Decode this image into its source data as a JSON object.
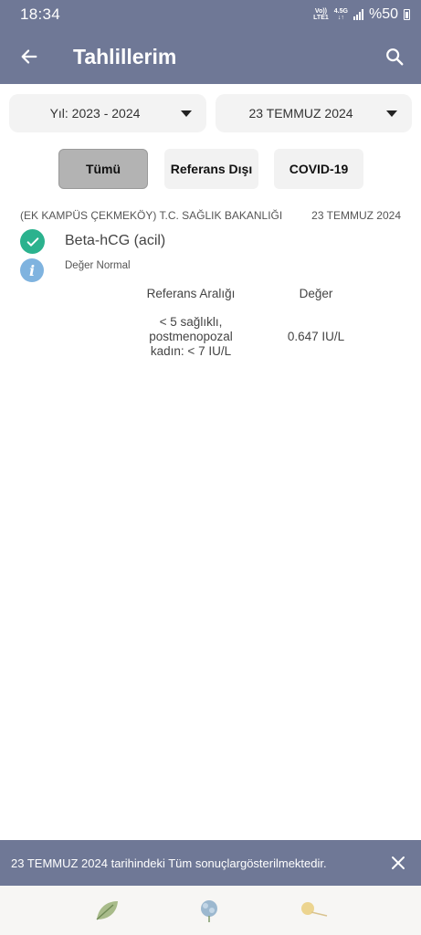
{
  "status_bar": {
    "time": "18:34",
    "network_top": "Vo))",
    "network_bottom": "LTE1",
    "gen_top": "4.5G",
    "gen_bottom": "↓↑",
    "battery_text": "%50"
  },
  "app_bar": {
    "title": "Tahlillerim",
    "back_icon": "arrow-left-icon",
    "search_icon": "search-icon"
  },
  "filters": {
    "year": "Yıl: 2023 - 2024",
    "date": "23 TEMMUZ 2024"
  },
  "tabs": [
    {
      "label": "Tümü",
      "active": true
    },
    {
      "label": "Referans Dışı",
      "active": false
    },
    {
      "label": "COVID-19",
      "active": false
    }
  ],
  "result": {
    "institution": "(EK KAMPÜS ÇEKMEKÖY) T.C. SAĞLIK BAKANLIĞI",
    "date": "23 TEMMUZ 2024",
    "test_name": "Beta-hCG (acil)",
    "status": "Değer Normal",
    "col_reference": "Referans Aralığı",
    "col_value": "Değer",
    "reference_line1": "< 5 sağlıklı,",
    "reference_line2": "postmenopozal",
    "reference_line3": "kadın: < 7 IU/L",
    "value": "0.647 IU/L",
    "colors": {
      "ok": "#2bb28e",
      "info": "#7fb3df"
    }
  },
  "snackbar": {
    "message": "23 TEMMUZ 2024 tarihindeki Tüm sonuçlargösterilmektedir."
  },
  "bottom_icons": [
    "leaf-icon",
    "flower-icon",
    "dandelion-icon"
  ],
  "theme": {
    "primary": "#6f7896"
  }
}
